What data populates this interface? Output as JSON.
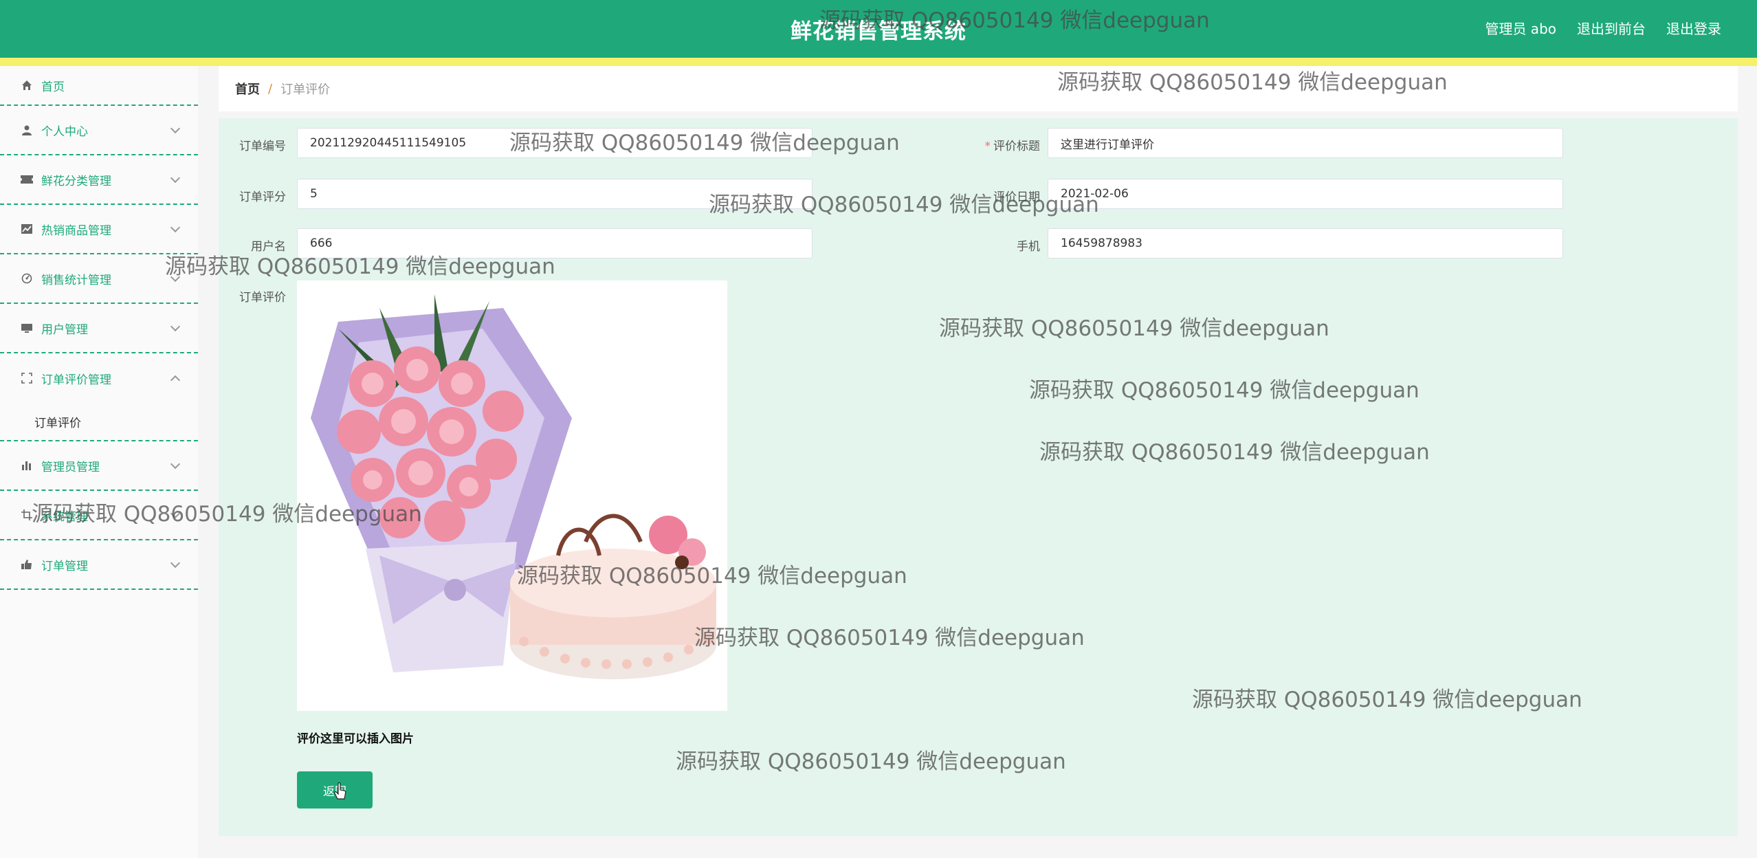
{
  "header": {
    "title": "鲜花销售管理系统",
    "user_label": "管理员 abo",
    "frontend_link": "退出到前台",
    "logout_link": "退出登录"
  },
  "sidebar": {
    "items": [
      {
        "label": "首页",
        "icon": "home-icon"
      },
      {
        "label": "个人中心",
        "icon": "user-icon"
      },
      {
        "label": "鲜花分类管理",
        "icon": "ticket-icon"
      },
      {
        "label": "热销商品管理",
        "icon": "chart-line-icon"
      },
      {
        "label": "销售统计管理",
        "icon": "dashboard-icon"
      },
      {
        "label": "用户管理",
        "icon": "monitor-icon"
      },
      {
        "label": "订单评价管理",
        "icon": "fullscreen-icon",
        "expanded": true
      },
      {
        "label": "管理员管理",
        "icon": "bar-chart-icon"
      },
      {
        "label": "系统管理",
        "icon": "crop-icon"
      },
      {
        "label": "订单管理",
        "icon": "thumb-up-icon"
      }
    ],
    "sub_item": "订单评价"
  },
  "breadcrumb": {
    "home": "首页",
    "separator": "/",
    "current": "订单评价"
  },
  "form": {
    "order_no_label": "订单编号",
    "order_no": "20211292044511154910​5",
    "title_label": "评价标题",
    "title_value": "这里进行订单评价",
    "rating_label": "订单评分",
    "rating_value": "5",
    "date_label": "评价日期",
    "date_value": "2021-02-06",
    "username_label": "用户名",
    "username_value": "666",
    "phone_label": "手机",
    "phone_value": "16459878983",
    "review_label": "订单评价",
    "review_caption": "评价这里可以插入图片",
    "back_button": "返回"
  },
  "watermark": "源码获取 QQ86050149 微信deepguan",
  "colors": {
    "primary": "#1fa97a",
    "stripe": "#f6f06a",
    "panel": "#e4f5ee"
  }
}
